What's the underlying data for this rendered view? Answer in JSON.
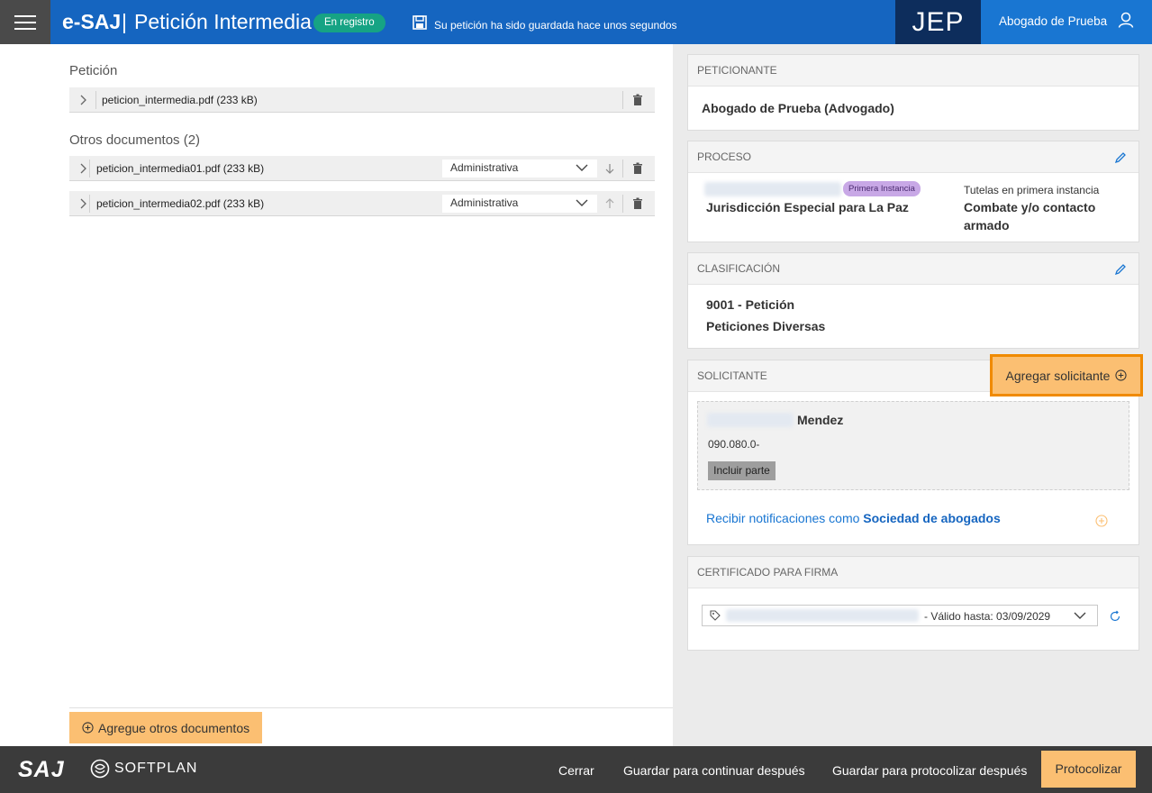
{
  "header": {
    "brand": "e-SAJ",
    "separator": "|",
    "title": "Petición Intermedia",
    "status": "En registro",
    "save_message": "Su petición ha sido guardada hace unos segundos",
    "org": "JEP",
    "user": "Abogado de Prueba"
  },
  "left": {
    "peticion_label": "Petición",
    "main_doc": "peticion_intermedia.pdf (233 kB)",
    "others_label": "Otros documentos (2)",
    "others": [
      {
        "name": "peticion_intermedia01.pdf (233 kB)",
        "type": "Administrativa"
      },
      {
        "name": "peticion_intermedia02.pdf (233 kB)",
        "type": "Administrativa"
      }
    ],
    "add_docs": "Agregue otros documentos"
  },
  "right": {
    "peticionante": {
      "title": "PETICIONANTE",
      "value": "Abogado de Prueba (Advogado)"
    },
    "proceso": {
      "title": "PROCESO",
      "instancia": "Primera Instancia",
      "jurisdiccion": "Jurisdicción Especial para La Paz",
      "tutela_label": "Tutelas en primera instancia",
      "tutela_value_1": "Combate y/o contacto",
      "tutela_value_2": "armado"
    },
    "clasificacion": {
      "title": "CLASIFICACIÓN",
      "line1": "9001 - Petición",
      "line2": "Peticiones Diversas"
    },
    "solicitante": {
      "title": "SOLICITANTE",
      "add_button": "Agregar solicitante",
      "surname": "Mendez",
      "doc_number": "090.080.0-",
      "include_button": "Incluir parte",
      "notif_prefix": "Recibir notificaciones como",
      "notif_bold": "Sociedad de abogados"
    },
    "certificado": {
      "title": "CERTIFICADO PARA FIRMA",
      "valid": "- Válido hasta: 03/09/2029"
    }
  },
  "footer": {
    "logo": "SAJ",
    "softplan": "SOFTPLAN",
    "close": "Cerrar",
    "save_continue": "Guardar para continuar después",
    "save_protocol": "Guardar para protocolizar después",
    "protocol": "Protocolizar"
  },
  "colors": {
    "primary": "#1565c0",
    "accent": "#fbbf72",
    "highlight": "#f08a00",
    "badge_green": "#16a384"
  }
}
